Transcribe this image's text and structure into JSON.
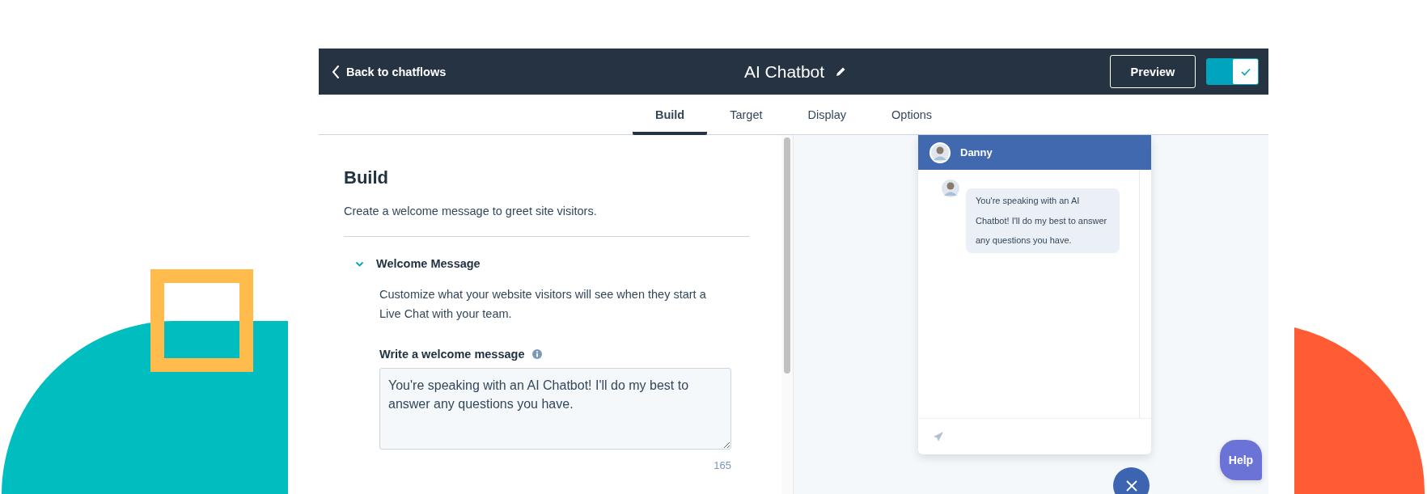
{
  "header": {
    "back_link": "Back to chatflows",
    "title": "AI Chatbot",
    "preview_button": "Preview",
    "toggle": {
      "on": true
    }
  },
  "tabs": [
    {
      "label": "Build",
      "selected": true
    },
    {
      "label": "Target",
      "selected": false
    },
    {
      "label": "Display",
      "selected": false
    },
    {
      "label": "Options",
      "selected": false
    }
  ],
  "build_panel": {
    "heading": "Build",
    "description": "Create a welcome message to greet site visitors.",
    "section": {
      "title": "Welcome Message",
      "expanded": true,
      "description": "Customize what your website visitors will see when they start a Live Chat with your team.",
      "field_label": "Write a welcome message",
      "field_value": "You're speaking with an AI Chatbot! I'll do my best to answer any questions you have.",
      "char_count": "165"
    }
  },
  "preview": {
    "agent_name": "Danny",
    "message": "You're speaking with an AI Chatbot! I'll do my best to answer any questions you have.",
    "help_button": "Help"
  }
}
